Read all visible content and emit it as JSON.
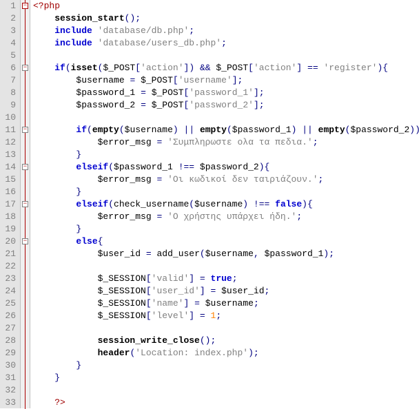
{
  "lines": [
    {
      "n": 1,
      "fold": "minus-red",
      "segs": [
        [
          "tag",
          "<?php"
        ]
      ]
    },
    {
      "n": 2,
      "segs": [
        [
          "nm",
          "    "
        ],
        [
          "fn",
          "session_start"
        ],
        [
          "paren",
          "();"
        ]
      ]
    },
    {
      "n": 3,
      "segs": [
        [
          "nm",
          "    "
        ],
        [
          "kw",
          "include"
        ],
        [
          "nm",
          " "
        ],
        [
          "str",
          "'database/db.php'"
        ],
        [
          "paren",
          ";"
        ]
      ]
    },
    {
      "n": 4,
      "segs": [
        [
          "nm",
          "    "
        ],
        [
          "kw",
          "include"
        ],
        [
          "nm",
          " "
        ],
        [
          "str",
          "'database/users_db.php'"
        ],
        [
          "paren",
          ";"
        ]
      ]
    },
    {
      "n": 5,
      "segs": []
    },
    {
      "n": 6,
      "fold": "minus",
      "segs": [
        [
          "nm",
          "    "
        ],
        [
          "kw",
          "if"
        ],
        [
          "paren",
          "("
        ],
        [
          "fn",
          "isset"
        ],
        [
          "paren",
          "("
        ],
        [
          "var",
          "$_POST"
        ],
        [
          "paren",
          "["
        ],
        [
          "str",
          "'action'"
        ],
        [
          "paren",
          "])"
        ],
        [
          "nm",
          " "
        ],
        [
          "op",
          "&&"
        ],
        [
          "nm",
          " "
        ],
        [
          "var",
          "$_POST"
        ],
        [
          "paren",
          "["
        ],
        [
          "str",
          "'action'"
        ],
        [
          "paren",
          "]"
        ],
        [
          "nm",
          " "
        ],
        [
          "op",
          "=="
        ],
        [
          "nm",
          " "
        ],
        [
          "str",
          "'register'"
        ],
        [
          "paren",
          ")"
        ],
        [
          "brace",
          "{"
        ]
      ]
    },
    {
      "n": 7,
      "segs": [
        [
          "nm",
          "        "
        ],
        [
          "var",
          "$username"
        ],
        [
          "nm",
          " "
        ],
        [
          "op",
          "="
        ],
        [
          "nm",
          " "
        ],
        [
          "var",
          "$_POST"
        ],
        [
          "paren",
          "["
        ],
        [
          "str",
          "'username'"
        ],
        [
          "paren",
          "];"
        ]
      ]
    },
    {
      "n": 8,
      "segs": [
        [
          "nm",
          "        "
        ],
        [
          "var",
          "$password_1"
        ],
        [
          "nm",
          " "
        ],
        [
          "op",
          "="
        ],
        [
          "nm",
          " "
        ],
        [
          "var",
          "$_POST"
        ],
        [
          "paren",
          "["
        ],
        [
          "str",
          "'password_1'"
        ],
        [
          "paren",
          "];"
        ]
      ]
    },
    {
      "n": 9,
      "segs": [
        [
          "nm",
          "        "
        ],
        [
          "var",
          "$password_2"
        ],
        [
          "nm",
          " "
        ],
        [
          "op",
          "="
        ],
        [
          "nm",
          " "
        ],
        [
          "var",
          "$_POST"
        ],
        [
          "paren",
          "["
        ],
        [
          "str",
          "'password_2'"
        ],
        [
          "paren",
          "];"
        ]
      ]
    },
    {
      "n": 10,
      "segs": []
    },
    {
      "n": 11,
      "fold": "minus",
      "segs": [
        [
          "nm",
          "        "
        ],
        [
          "kw",
          "if"
        ],
        [
          "paren",
          "("
        ],
        [
          "fn",
          "empty"
        ],
        [
          "paren",
          "("
        ],
        [
          "var",
          "$username"
        ],
        [
          "paren",
          ")"
        ],
        [
          "nm",
          " "
        ],
        [
          "op",
          "||"
        ],
        [
          "nm",
          " "
        ],
        [
          "fn",
          "empty"
        ],
        [
          "paren",
          "("
        ],
        [
          "var",
          "$password_1"
        ],
        [
          "paren",
          ")"
        ],
        [
          "nm",
          " "
        ],
        [
          "op",
          "||"
        ],
        [
          "nm",
          " "
        ],
        [
          "fn",
          "empty"
        ],
        [
          "paren",
          "("
        ],
        [
          "var",
          "$password_2"
        ],
        [
          "paren",
          ")){"
        ]
      ]
    },
    {
      "n": 12,
      "segs": [
        [
          "nm",
          "            "
        ],
        [
          "var",
          "$error_msg"
        ],
        [
          "nm",
          " "
        ],
        [
          "op",
          "="
        ],
        [
          "nm",
          " "
        ],
        [
          "str",
          "'Συμπληρωστε ολα τα πεδια.'"
        ],
        [
          "paren",
          ";"
        ]
      ]
    },
    {
      "n": 13,
      "segs": [
        [
          "nm",
          "        "
        ],
        [
          "brace",
          "}"
        ]
      ]
    },
    {
      "n": 14,
      "fold": "minus",
      "segs": [
        [
          "nm",
          "        "
        ],
        [
          "kw",
          "elseif"
        ],
        [
          "paren",
          "("
        ],
        [
          "var",
          "$password_1"
        ],
        [
          "nm",
          " "
        ],
        [
          "op",
          "!=="
        ],
        [
          "nm",
          " "
        ],
        [
          "var",
          "$password_2"
        ],
        [
          "paren",
          ")"
        ],
        [
          "brace",
          "{"
        ]
      ]
    },
    {
      "n": 15,
      "segs": [
        [
          "nm",
          "            "
        ],
        [
          "var",
          "$error_msg"
        ],
        [
          "nm",
          " "
        ],
        [
          "op",
          "="
        ],
        [
          "nm",
          " "
        ],
        [
          "str",
          "'Οι κωδικοί δεν ταιριάζουν.'"
        ],
        [
          "paren",
          ";"
        ]
      ]
    },
    {
      "n": 16,
      "segs": [
        [
          "nm",
          "        "
        ],
        [
          "brace",
          "}"
        ]
      ]
    },
    {
      "n": 17,
      "fold": "minus",
      "segs": [
        [
          "nm",
          "        "
        ],
        [
          "kw",
          "elseif"
        ],
        [
          "paren",
          "("
        ],
        [
          "nm",
          "check_username"
        ],
        [
          "paren",
          "("
        ],
        [
          "var",
          "$username"
        ],
        [
          "paren",
          ")"
        ],
        [
          "nm",
          " "
        ],
        [
          "op",
          "!=="
        ],
        [
          "nm",
          " "
        ],
        [
          "const",
          "false"
        ],
        [
          "paren",
          ")"
        ],
        [
          "brace",
          "{"
        ]
      ]
    },
    {
      "n": 18,
      "segs": [
        [
          "nm",
          "            "
        ],
        [
          "var",
          "$error_msg"
        ],
        [
          "nm",
          " "
        ],
        [
          "op",
          "="
        ],
        [
          "nm",
          " "
        ],
        [
          "str",
          "'Ο χρήστης υπάρχει ήδη.'"
        ],
        [
          "paren",
          ";"
        ]
      ]
    },
    {
      "n": 19,
      "segs": [
        [
          "nm",
          "        "
        ],
        [
          "brace",
          "}"
        ]
      ]
    },
    {
      "n": 20,
      "fold": "minus",
      "segs": [
        [
          "nm",
          "        "
        ],
        [
          "kw",
          "else"
        ],
        [
          "brace",
          "{"
        ]
      ]
    },
    {
      "n": 21,
      "segs": [
        [
          "nm",
          "            "
        ],
        [
          "var",
          "$user_id"
        ],
        [
          "nm",
          " "
        ],
        [
          "op",
          "="
        ],
        [
          "nm",
          " "
        ],
        [
          "nm",
          "add_user"
        ],
        [
          "paren",
          "("
        ],
        [
          "var",
          "$username"
        ],
        [
          "paren",
          ","
        ],
        [
          "nm",
          " "
        ],
        [
          "var",
          "$password_1"
        ],
        [
          "paren",
          ");"
        ]
      ]
    },
    {
      "n": 22,
      "segs": []
    },
    {
      "n": 23,
      "segs": [
        [
          "nm",
          "            "
        ],
        [
          "var",
          "$_SESSION"
        ],
        [
          "paren",
          "["
        ],
        [
          "str",
          "'valid'"
        ],
        [
          "paren",
          "]"
        ],
        [
          "nm",
          " "
        ],
        [
          "op",
          "="
        ],
        [
          "nm",
          " "
        ],
        [
          "const",
          "true"
        ],
        [
          "paren",
          ";"
        ]
      ]
    },
    {
      "n": 24,
      "segs": [
        [
          "nm",
          "            "
        ],
        [
          "var",
          "$_SESSION"
        ],
        [
          "paren",
          "["
        ],
        [
          "str",
          "'user_id'"
        ],
        [
          "paren",
          "]"
        ],
        [
          "nm",
          " "
        ],
        [
          "op",
          "="
        ],
        [
          "nm",
          " "
        ],
        [
          "var",
          "$user_id"
        ],
        [
          "paren",
          ";"
        ]
      ]
    },
    {
      "n": 25,
      "segs": [
        [
          "nm",
          "            "
        ],
        [
          "var",
          "$_SESSION"
        ],
        [
          "paren",
          "["
        ],
        [
          "str",
          "'name'"
        ],
        [
          "paren",
          "]"
        ],
        [
          "nm",
          " "
        ],
        [
          "op",
          "="
        ],
        [
          "nm",
          " "
        ],
        [
          "var",
          "$username"
        ],
        [
          "paren",
          ";"
        ]
      ]
    },
    {
      "n": 26,
      "segs": [
        [
          "nm",
          "            "
        ],
        [
          "var",
          "$_SESSION"
        ],
        [
          "paren",
          "["
        ],
        [
          "str",
          "'level'"
        ],
        [
          "paren",
          "]"
        ],
        [
          "nm",
          " "
        ],
        [
          "op",
          "="
        ],
        [
          "nm",
          " "
        ],
        [
          "num",
          "1"
        ],
        [
          "paren",
          ";"
        ]
      ]
    },
    {
      "n": 27,
      "segs": []
    },
    {
      "n": 28,
      "segs": [
        [
          "nm",
          "            "
        ],
        [
          "fn",
          "session_write_close"
        ],
        [
          "paren",
          "();"
        ]
      ]
    },
    {
      "n": 29,
      "segs": [
        [
          "nm",
          "            "
        ],
        [
          "fn",
          "header"
        ],
        [
          "paren",
          "("
        ],
        [
          "str",
          "'Location: index.php'"
        ],
        [
          "paren",
          ");"
        ]
      ]
    },
    {
      "n": 30,
      "segs": [
        [
          "nm",
          "        "
        ],
        [
          "brace",
          "}"
        ]
      ]
    },
    {
      "n": 31,
      "segs": [
        [
          "nm",
          "    "
        ],
        [
          "brace",
          "}"
        ]
      ]
    },
    {
      "n": 32,
      "segs": []
    },
    {
      "n": 33,
      "segs": [
        [
          "nm",
          "    "
        ],
        [
          "tag",
          "?>"
        ]
      ]
    }
  ]
}
